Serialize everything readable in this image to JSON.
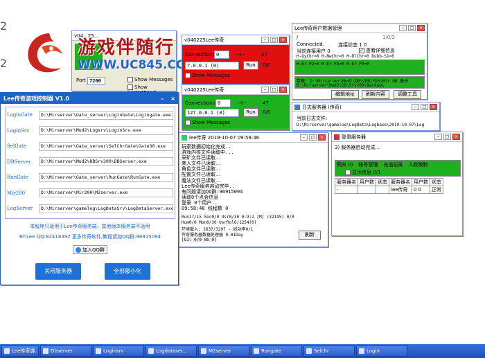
{
  "watermark": {
    "text": "游戏伴随行",
    "url": "WWW.UC845.COM"
  },
  "win_gate_small": {
    "title": "v04...25...",
    "port_label": "Port",
    "port_value": "7200",
    "show_messages": "Show Messages",
    "show_socket": "Show SocketRead"
  },
  "win_red": {
    "title": "v040225Lee传奇",
    "connections_label": "Connections:",
    "connections_value": "0",
    "arrow": "--I--",
    "count": "47",
    "ip": "7.0.0.1 (0)",
    "run": "Run",
    "ratio": "0/0",
    "show_messages": "Show Messages"
  },
  "win_green": {
    "title": "v040225Lee传奇",
    "connections_label": "Connections:",
    "connections_value": "0",
    "arrow": "--I--",
    "count": "47",
    "ip": "127.0.0.1 (0)",
    "run": "Run",
    "ratio": "0/0",
    "show_messages": "Show Messages"
  },
  "win_userdata": {
    "title": "Lee传奇用户数据管理",
    "slash": "/",
    "page": "1/0/2",
    "connected": "Connected.",
    "conn_status": "连接状态 1    0",
    "cur_users": "当前连接用户 0",
    "check_label": "查看详细信息",
    "h_row1": "H-QyChr=0    H-NwChr=0    H-DlChr=0    Dubb-S1=0",
    "h_row2": "H-Er-P2=0  H-Er-P3=0  H-Er-P4=0",
    "path_line1": "数据: D:\\Mirserver\\Mud2\\DB\\GDB\\FDB\\Mir.DB   备份",
    "path_line2": "D:\\Mirserver\\Mud2\\DB\\Srv200\\Backup\\",
    "btn_edit": "编辑地址",
    "btn_refresh": "刷新内容",
    "btn_tools": "调整工具"
  },
  "win_log": {
    "title": "日志服务器 (传奇)",
    "today_log": "当前日志文件:",
    "log_path": "D:\\Mirserver\\gamelog\\LogData\\Logbase\\2019-10-07\\Log"
  },
  "win_login": {
    "title": "登录服务器",
    "status": "3) 服务器启动完成...",
    "tabs": [
      "网关 0)",
      "帐号管理",
      "充值记录",
      "人数限制"
    ],
    "show_info": "显示信息 0/1",
    "columns": [
      "服务器名",
      "用户数",
      "状态",
      "服务器名",
      "用户数",
      "状态"
    ],
    "rows": [
      [
        "-",
        "",
        "",
        "lee传奇",
        "0 0",
        "正常"
      ]
    ]
  },
  "win_lee_main": {
    "title": "lee传奇 2019-10-07 09:58:46",
    "log_lines": [
      "玩家数据初始化完成..",
      "游戏内核文件读取中...",
      "采矿文件已读取..",
      "商人文件已读取..",
      "角色文件已读取..",
      "配置文件已读取..",
      "魔法文件已读取..",
      "Lee传奇服务启动完毕..",
      "有问题请加QQ群:96915094",
      "读取0个点会信息",
      "登录 0个用户..",
      "09:58:48 线程数 0"
    ],
    "stat1": "Run17/15 Soc0/0 Usr0/30 0:9:2 [M]    (32195)   0/0",
    "stat2": "Hum0/0 Mon0/30 UsrRol6/1254(0)",
    "stat3": "环境载入: 2637/3297 - 线功率0/1",
    "stat4": "传奇服务器数据处理器           0.01Day",
    "stat5": "[G1: 0/0 0b 0]",
    "refresh_btn": "刷新"
  },
  "controller": {
    "title": "Lee传奇游戏控制器  V1.0",
    "rows": [
      {
        "label": "LoginGate",
        "path": "D:\\Mirserver\\Gate_server\\LoginGate\\Logingate.exe"
      },
      {
        "label": "LoginSrv",
        "path": "D:\\Mirserver\\Mud2\\Logsrv\\LoginSrv.exe"
      },
      {
        "label": "SelGate",
        "path": "D:\\Mirserver\\Gate_server\\SelChrGate\\Gate30.exe"
      },
      {
        "label": "DBServer",
        "path": "D:\\Mirserver\\Mud2\\DBSrv200\\DBServer.exe"
      },
      {
        "label": "RunGate",
        "path": "D:\\Mirserver\\Gate_server\\RunGate\\RunGate.exe"
      },
      {
        "label": "Mir200",
        "path": "D:\\Mirserver\\Mir200\\M2server.exe"
      },
      {
        "label": "LogServer",
        "path": "D:\\Mirserver\\gamelog\\LogDataSrv\\LogDataServer.exe"
      }
    ],
    "note": "本程序只适用于Lee传奇服务端，其他版本服务端不适用",
    "contact": "BY:Lee  QQ:82418392  更多传奇软件,教程请加QQ群:96915094",
    "qq_group": "加入QQ群",
    "btn_close": "关闭服务器",
    "btn_minimize": "全部最小化"
  },
  "taskbar": [
    "Lee传奇游...",
    "Dbserver",
    "Loginsrv",
    "Logdataser...",
    "M2server",
    "Rungate",
    "Selchr",
    "Login"
  ],
  "colors": {
    "red_panel": "#e01010",
    "green_panel": "#1fb01f",
    "controller_blue": "#1b63c8",
    "taskbar": "#2757c4"
  }
}
